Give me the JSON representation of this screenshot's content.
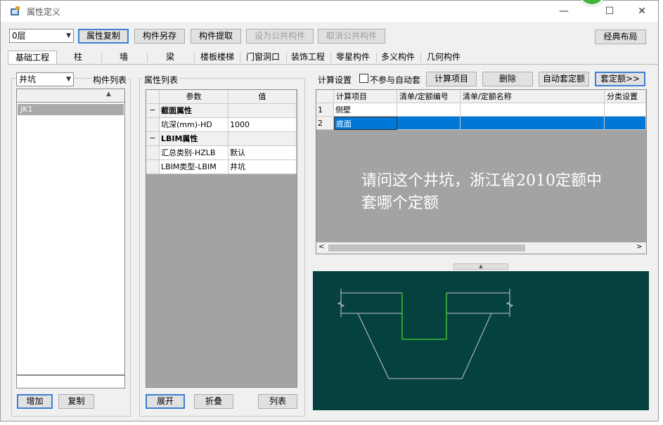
{
  "window": {
    "title": "属性定义",
    "minimize": "—",
    "maximize": "☐",
    "close": "✕"
  },
  "toolbar": {
    "floor_select": "0层",
    "buttons": [
      "属性复制",
      "构件另存",
      "构件提取",
      "设为公共构件",
      "取消公共构件"
    ],
    "classic_layout": "经典布局"
  },
  "tabs": [
    "基础工程",
    "柱",
    "墙",
    "梁",
    "楼板楼梯",
    "门窗洞口",
    "装饰工程",
    "零星构件",
    "多义构件",
    "几何构件"
  ],
  "left_panel": {
    "type_select": "井坑",
    "title": "构件列表",
    "items": [
      "JK1"
    ],
    "add_button": "增加",
    "copy_button": "复制"
  },
  "property_panel": {
    "title": "属性列表",
    "col_param": "参数",
    "col_value": "值",
    "rows": [
      {
        "toggle": "−",
        "param": "截面属性",
        "value": "",
        "group": true
      },
      {
        "toggle": "",
        "param": "坑深(mm)-HD",
        "value": "1000",
        "group": false
      },
      {
        "toggle": "−",
        "param": "LBIM属性",
        "value": "",
        "group": true
      },
      {
        "toggle": "",
        "param": "汇总类别-HZLB",
        "value": "默认",
        "group": false
      },
      {
        "toggle": "",
        "param": "LBIM类型-LBIM",
        "value": "井坑",
        "group": false
      }
    ],
    "expand_button": "展开",
    "collapse_button": "折叠",
    "list_button": "列表"
  },
  "calc_panel": {
    "title": "计算设置",
    "checkbox_label": "不参与自动套",
    "calc_item_button": "计算项目",
    "delete_button": "删除",
    "auto_quota_button": "自动套定额",
    "apply_quota_button": "套定额>>",
    "columns": [
      "计算项目",
      "清单/定额编号",
      "清单/定额名称",
      "分类设置"
    ],
    "rows": [
      {
        "num": "1",
        "item": "侧壁"
      },
      {
        "num": "2",
        "item": "底面"
      }
    ]
  },
  "question_overlay": {
    "line1": "请问这个井坑，浙江省2010定额中",
    "line2": "套哪个定额"
  },
  "colors": {
    "accent": "#3c7fd4",
    "selection": "#0078d7",
    "canvas_bg": "#05413f",
    "pit_line": "#c8c8c8",
    "pit_bottom": "#4bd12a"
  }
}
